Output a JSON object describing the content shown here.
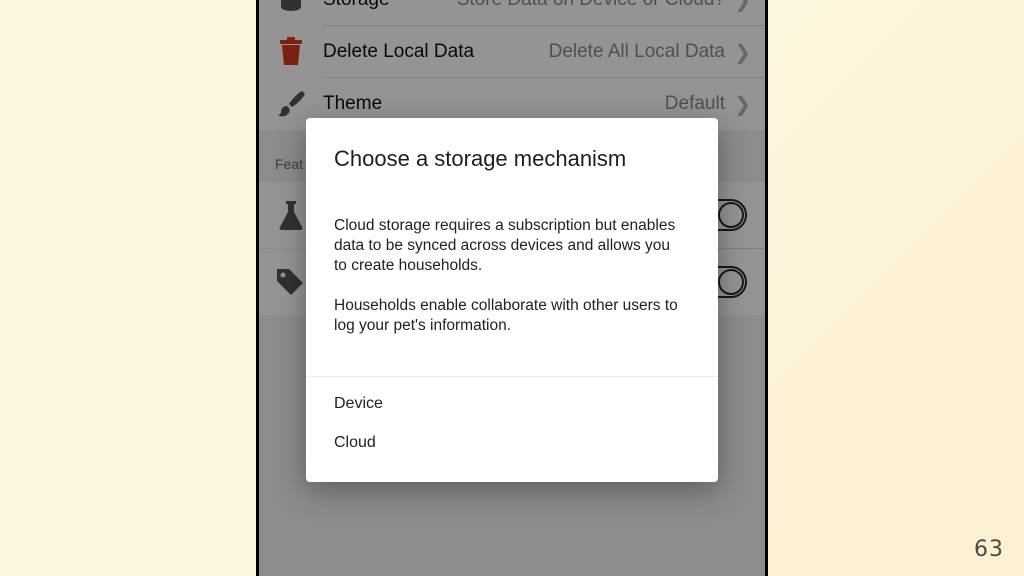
{
  "slide": {
    "number": "63"
  },
  "settings": {
    "rows": [
      {
        "label": "Storage",
        "value": "Store Data on Device or Cloud?",
        "icon": "database-icon"
      },
      {
        "label": "Delete Local Data",
        "value": "Delete All Local Data",
        "icon": "trash-icon",
        "icon_color": "#d9381e"
      },
      {
        "label": "Theme",
        "value": "Default",
        "icon": "paintbrush-icon"
      }
    ],
    "section_header": "Feat",
    "feature_rows": [
      {
        "icon": "flask-icon"
      },
      {
        "icon": "tag-icon"
      }
    ]
  },
  "dialog": {
    "title": "Choose a storage mechanism",
    "paragraph_1": "Cloud storage requires a subscription but enables data to be synced across devices and allows you to create households.",
    "paragraph_2": "Households enable collaborate with other users to log your pet's information.",
    "options": [
      "Device",
      "Cloud"
    ]
  }
}
